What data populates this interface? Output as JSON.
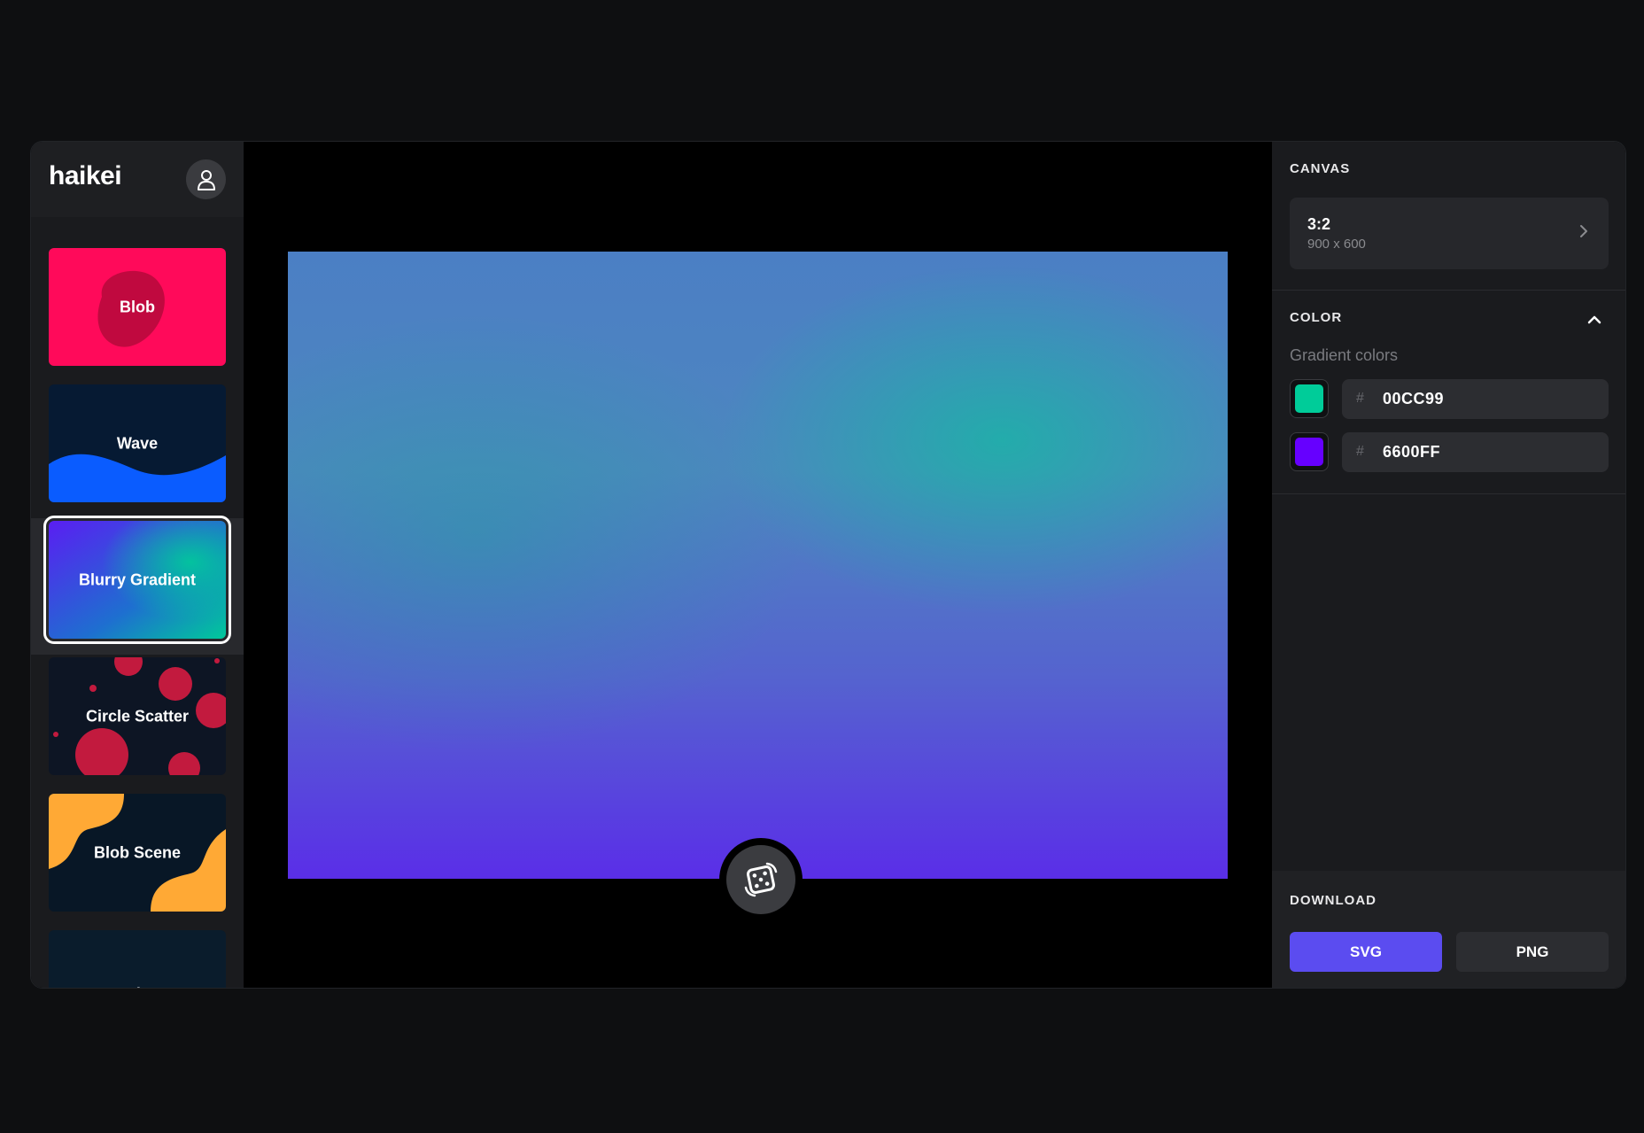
{
  "app": {
    "logo": "haikei"
  },
  "generators": [
    {
      "label": "Blob"
    },
    {
      "label": "Wave"
    },
    {
      "label": "Blurry Gradient",
      "selected": true
    },
    {
      "label": "Circle Scatter"
    },
    {
      "label": "Blob Scene"
    },
    {
      "label": "Layered Waves"
    }
  ],
  "canvas": {
    "title": "CANVAS",
    "ratio": "3:2",
    "size": "900 x 600"
  },
  "color": {
    "title": "COLOR",
    "subtitle": "Gradient colors",
    "hash": "#",
    "colors": [
      {
        "hex": "00CC99",
        "swatch": "#00CC99"
      },
      {
        "hex": "6600FF",
        "swatch": "#6600FF"
      }
    ]
  },
  "download": {
    "title": "DOWNLOAD",
    "svg_label": "SVG",
    "png_label": "PNG"
  }
}
